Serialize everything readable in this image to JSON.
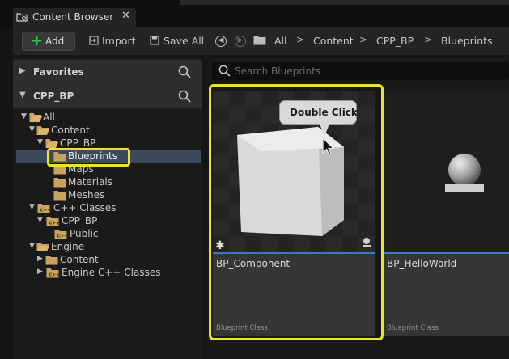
{
  "tab": {
    "title": "Content Browser",
    "close": "✕"
  },
  "toolbar": {
    "add": "Add",
    "import": "Import",
    "save_all": "Save All",
    "breadcrumbs": [
      "All",
      "Content",
      "CPP_BP",
      "Blueprints"
    ]
  },
  "sections": {
    "favorites": "Favorites",
    "project": "CPP_BP"
  },
  "tree": [
    {
      "label": "All"
    },
    {
      "label": "Content"
    },
    {
      "label": "CPP_BP"
    },
    {
      "label": "Blueprints"
    },
    {
      "label": "Maps"
    },
    {
      "label": "Materials"
    },
    {
      "label": "Meshes"
    },
    {
      "label": "C++ Classes"
    },
    {
      "label": "CPP_BP"
    },
    {
      "label": "Public"
    },
    {
      "label": "Engine"
    },
    {
      "label": "Content"
    },
    {
      "label": "Engine C++ Classes"
    }
  ],
  "search": {
    "placeholder": "Search Blueprints"
  },
  "assets": [
    {
      "name": "BP_Component",
      "type": "Blueprint Class"
    },
    {
      "name": "BP_HelloWorld",
      "type": "Blueprint Class"
    }
  ],
  "tooltip": "Double Click",
  "colors": {
    "highlight": "#ebe32c",
    "add_plus": "#35c04a",
    "folder": "#c9a45f",
    "asset_underline": "#3a78c8"
  }
}
